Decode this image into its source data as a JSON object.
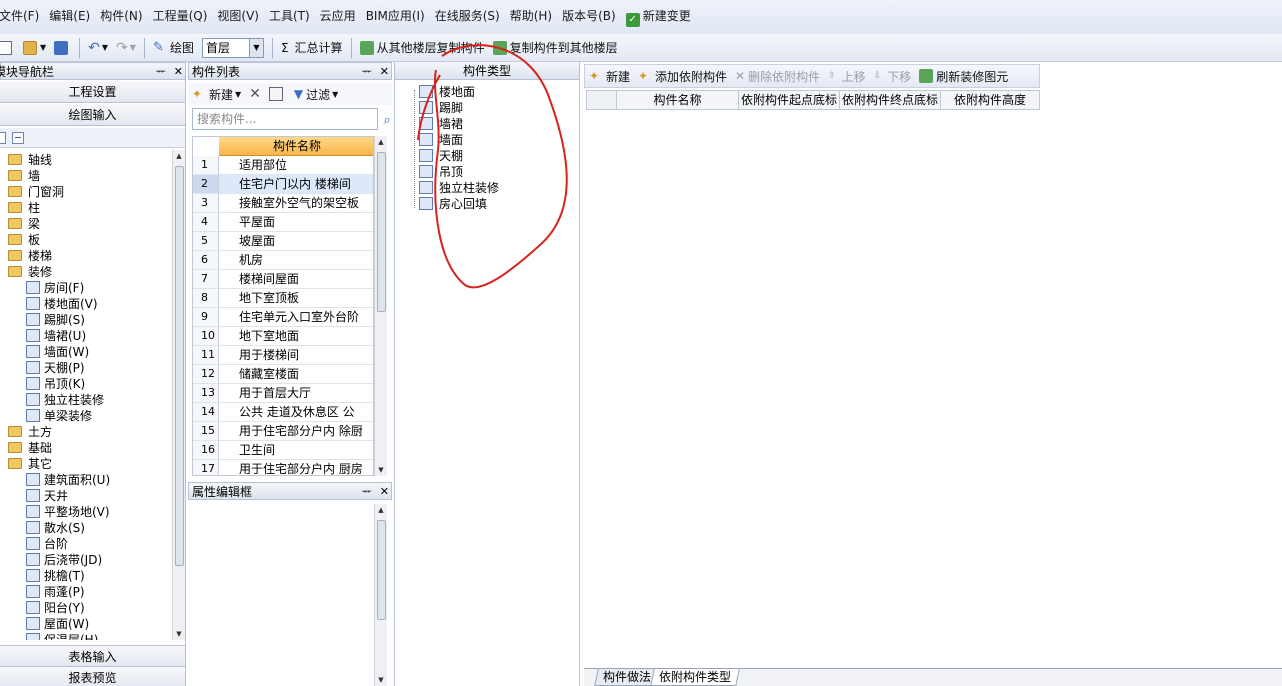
{
  "menu": [
    "文件(F)",
    "编辑(E)",
    "构件(N)",
    "工程量(Q)",
    "视图(V)",
    "工具(T)",
    "云应用",
    "BIM应用(I)",
    "在线服务(S)",
    "帮助(H)",
    "版本号(B)",
    "新建变更"
  ],
  "toolbar": {
    "draw_label": "绘图",
    "floor_value": "首层",
    "sum_label": "汇总计算",
    "copy_from_label": "从其他楼层复制构件",
    "copy_to_label": "复制构件到其他楼层"
  },
  "nav": {
    "title": "模块导航栏",
    "project_settings": "工程设置",
    "draw_input": "绘图输入",
    "table_input": "表格输入",
    "report_preview": "报表预览",
    "tree": [
      {
        "label": "轴线",
        "type": "folder",
        "level": 0
      },
      {
        "label": "墙",
        "type": "folder",
        "level": 0
      },
      {
        "label": "门窗洞",
        "type": "folder",
        "level": 0
      },
      {
        "label": "柱",
        "type": "folder",
        "level": 0
      },
      {
        "label": "梁",
        "type": "folder",
        "level": 0
      },
      {
        "label": "板",
        "type": "folder",
        "level": 0
      },
      {
        "label": "楼梯",
        "type": "folder",
        "level": 0
      },
      {
        "label": "装修",
        "type": "folder",
        "level": 0
      },
      {
        "label": "房间(F)",
        "type": "leaf",
        "level": 1
      },
      {
        "label": "楼地面(V)",
        "type": "leaf",
        "level": 1
      },
      {
        "label": "踢脚(S)",
        "type": "leaf",
        "level": 1
      },
      {
        "label": "墙裙(U)",
        "type": "leaf",
        "level": 1
      },
      {
        "label": "墙面(W)",
        "type": "leaf",
        "level": 1
      },
      {
        "label": "天棚(P)",
        "type": "leaf",
        "level": 1
      },
      {
        "label": "吊顶(K)",
        "type": "leaf",
        "level": 1
      },
      {
        "label": "独立柱装修",
        "type": "leaf",
        "level": 1
      },
      {
        "label": "单梁装修",
        "type": "leaf",
        "level": 1
      },
      {
        "label": "土方",
        "type": "folder",
        "level": 0
      },
      {
        "label": "基础",
        "type": "folder",
        "level": 0
      },
      {
        "label": "其它",
        "type": "folder",
        "level": 0
      },
      {
        "label": "建筑面积(U)",
        "type": "leaf",
        "level": 1
      },
      {
        "label": "天井",
        "type": "leaf",
        "level": 1
      },
      {
        "label": "平整场地(V)",
        "type": "leaf",
        "level": 1
      },
      {
        "label": "散水(S)",
        "type": "leaf",
        "level": 1
      },
      {
        "label": "台阶",
        "type": "leaf",
        "level": 1
      },
      {
        "label": "后浇带(JD)",
        "type": "leaf",
        "level": 1
      },
      {
        "label": "挑檐(T)",
        "type": "leaf",
        "level": 1
      },
      {
        "label": "雨蓬(P)",
        "type": "leaf",
        "level": 1
      },
      {
        "label": "阳台(Y)",
        "type": "leaf",
        "level": 1
      },
      {
        "label": "屋面(W)",
        "type": "leaf",
        "level": 1
      },
      {
        "label": "保温层(H)",
        "type": "leaf",
        "level": 1
      }
    ]
  },
  "component_list": {
    "title": "构件列表",
    "new_label": "新建",
    "filter_label": "过滤",
    "search_placeholder": "搜索构件...",
    "column_header": "构件名称",
    "rows": [
      {
        "num": "1",
        "name": "适用部位"
      },
      {
        "num": "2",
        "name": "住宅户门以内 楼梯间"
      },
      {
        "num": "3",
        "name": "接触室外空气的架空板"
      },
      {
        "num": "4",
        "name": "平屋面"
      },
      {
        "num": "5",
        "name": "坡屋面"
      },
      {
        "num": "6",
        "name": "机房"
      },
      {
        "num": "7",
        "name": "楼梯间屋面"
      },
      {
        "num": "8",
        "name": "地下室顶板"
      },
      {
        "num": "9",
        "name": "住宅单元入口室外台阶"
      },
      {
        "num": "10",
        "name": "地下室地面"
      },
      {
        "num": "11",
        "name": "用于楼梯间"
      },
      {
        "num": "12",
        "name": "储藏室楼面"
      },
      {
        "num": "13",
        "name": "用于首层大厅"
      },
      {
        "num": "14",
        "name": "公共 走道及休息区 公"
      },
      {
        "num": "15",
        "name": "用于住宅部分户内 除厨"
      },
      {
        "num": "16",
        "name": "卫生间"
      },
      {
        "num": "17",
        "name": "用于住宅部分户内 厨房"
      }
    ],
    "selected_index": 1
  },
  "props": {
    "title": "属性编辑框"
  },
  "component_type": {
    "title": "构件类型",
    "items": [
      "楼地面",
      "踢脚",
      "墙裙",
      "墙面",
      "天棚",
      "吊顶",
      "独立柱装修",
      "房心回填"
    ]
  },
  "right": {
    "new_label": "新建",
    "add_attached_label": "添加依附构件",
    "delete_attached_label": "删除依附构件",
    "move_up_label": "上移",
    "move_down_label": "下移",
    "refresh_label": "刷新装修图元",
    "columns": [
      "构件名称",
      "依附构件起点底标",
      "依附构件终点底标",
      "依附构件高度"
    ],
    "tabs": [
      "构件做法",
      "依附构件类型"
    ]
  },
  "colors": {
    "header_orange": "#f7b64a",
    "annotation_red": "#d8231c",
    "selection_blue": "#dde9fb"
  }
}
